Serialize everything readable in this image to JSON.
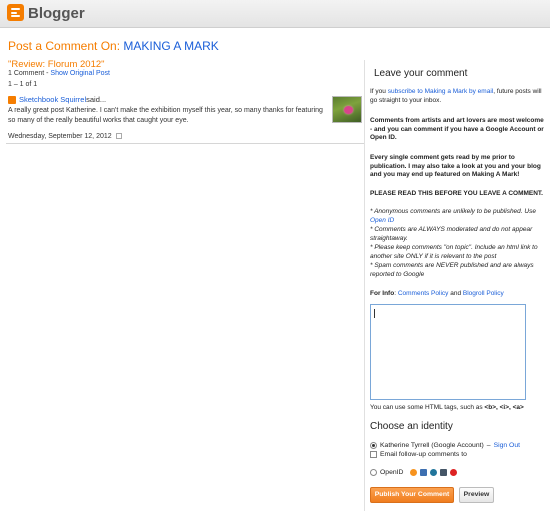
{
  "header": {
    "logo_text": "Blogger"
  },
  "post": {
    "heading_prefix": "Post a Comment On:",
    "blog_name": "MAKING A MARK",
    "title": "\"Review: Florum 2012\"",
    "comment_count": "1 Comment",
    "count_separator": " - ",
    "show_original": "Show Original Post",
    "range": "1 – 1 of 1"
  },
  "comment": {
    "author": "Sketchbook Squirrel",
    "said": " said...",
    "body": "A really great post Katherine. I can't make the exhibition myself this year, so many thanks for featuring so many of the really beautiful works that caught your eye.",
    "date": "Wednesday, September 12, 2012"
  },
  "sidebar": {
    "title": "Leave your comment",
    "intro_prefix": "If you ",
    "intro_link": "subscribe to Making a Mark by email",
    "intro_suffix": ", future posts will go straight to your inbox.",
    "welcome": "Comments from artists and art lovers are most welcome - and you can comment if you have a Google Account or Open ID.",
    "prior": "Every single comment gets read by me prior to publication. I may also take a look at you and your blog and you may end up featured on Making A Mark!",
    "please": "PLEASE READ THIS BEFORE YOU LEAVE A COMMENT.",
    "rule1_prefix": "* Anonymous comments are unlikely to be published. Use ",
    "rule1_link": "Open ID",
    "rule2": "* Comments are ALWAYS moderated and do not appear straightaway.",
    "rule3": "* Please keep comments \"on topic\". Include an html link to another site ONLY if it is relevant to the post",
    "rule4": "* Spam comments are NEVER published and are always reported to Google",
    "info_label": "For Info",
    "info_colon": ": ",
    "info_link1": "Comments Policy",
    "info_and": " and ",
    "info_link2": "Blogroll Policy",
    "html_hint": "You can use some HTML tags, such as ",
    "html_tags": "<b>, <i>, <a>",
    "choose_title": "Choose an identity",
    "identity_name": "Katherine Tyrrell (Google Account)",
    "identity_sep": " – ",
    "sign_out": "Sign Out",
    "email_followup": "Email follow-up comments to",
    "openid_label": "OpenID",
    "publish_label": "Publish Your Comment",
    "preview_label": "Preview"
  },
  "colors": {
    "accent": "#f57d00",
    "link": "#1a5ed8"
  }
}
